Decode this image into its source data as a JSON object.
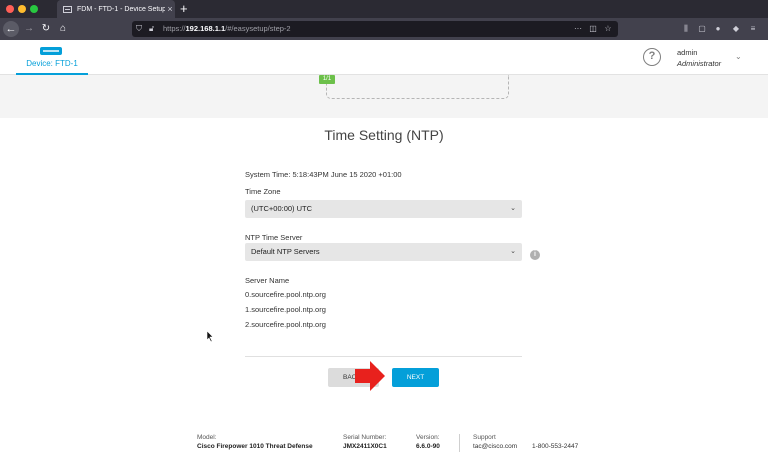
{
  "browser": {
    "tab_title": "FDM - FTD-1 - Device Setup",
    "tab_close": "×",
    "new_tab": "+",
    "url_prefix": "https://",
    "url_host": "192.168.1.1",
    "url_path": "/#/easysetup/step-2"
  },
  "header": {
    "device_label": "Device: FTD-1",
    "help_glyph": "?",
    "user_name": "admin",
    "user_role": "Administrator"
  },
  "diagram": {
    "page_badge": "1/1"
  },
  "form": {
    "title": "Time Setting (NTP)",
    "system_time": "System Time: 5:18:43PM June 15 2020 +01:00",
    "timezone_label": "Time Zone",
    "timezone_value": "(UTC+00:00) UTC",
    "ntp_label": "NTP Time Server",
    "ntp_value": "Default NTP Servers",
    "server_name_label": "Server Name",
    "servers": [
      "0.sourcefire.pool.ntp.org",
      "1.sourcefire.pool.ntp.org",
      "2.sourcefire.pool.ntp.org"
    ],
    "back_label": "BACK",
    "next_label": "NEXT"
  },
  "footer": {
    "model_label": "Model:",
    "model_value": "Cisco Firepower 1010 Threat Defense",
    "serial_label": "Serial Number:",
    "serial_value": "JMX2411X0C1",
    "version_label": "Version:",
    "version_value": "6.6.0-90",
    "support_label": "Support",
    "support_email": "tac@cisco.com",
    "support_phone": "1-800-553-2447"
  },
  "colors": {
    "accent": "#049fd9",
    "badge": "#6cc04a",
    "arrow": "#e8211d"
  }
}
